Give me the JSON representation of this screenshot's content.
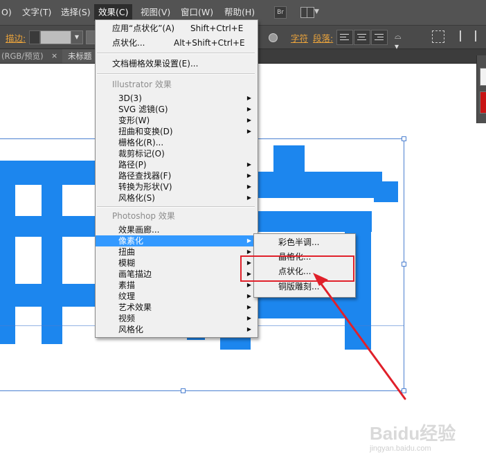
{
  "menubar": {
    "items": [
      "O)",
      "文字(T)",
      "选择(S)",
      "效果(C)",
      "视图(V)",
      "窗口(W)",
      "帮助(H)"
    ],
    "bridge_badge": "Br"
  },
  "control_bar": {
    "stroke_label": "描边:",
    "character_label": "字符",
    "paragraph_label": "段落:"
  },
  "tabs": {
    "doc_tab": "(RGB/预览)",
    "doc_tab_close": "×",
    "untitled_tab": "未标题"
  },
  "effect_menu": {
    "apply_last": {
      "label": "应用“点状化”(A)",
      "shortcut": "Shift+Ctrl+E"
    },
    "last_effect": {
      "label": "点状化...",
      "shortcut": "Alt+Shift+Ctrl+E"
    },
    "raster_settings": "文档栅格效果设置(E)...",
    "illustrator_header": "Illustrator 效果",
    "illustrator_items": [
      "3D(3)",
      "SVG 滤镜(G)",
      "变形(W)",
      "扭曲和变换(D)",
      "栅格化(R)...",
      "裁剪标记(O)",
      "路径(P)",
      "路径查找器(F)",
      "转换为形状(V)",
      "风格化(S)"
    ],
    "photoshop_header": "Photoshop 效果",
    "photoshop_items": [
      "效果画廊...",
      "像素化",
      "扭曲",
      "模糊",
      "画笔描边",
      "素描",
      "纹理",
      "艺术效果",
      "视频",
      "风格化"
    ]
  },
  "pixelate_submenu": {
    "items": [
      "彩色半调...",
      "晶格化...",
      "点状化...",
      "铜版雕刻..."
    ]
  },
  "watermark": {
    "brand": "Baidu经验",
    "url": "jingyan.baidu.com"
  },
  "colors": {
    "text_fill": "#1c86ee",
    "highlight": "#3399ff",
    "annotation": "#e0202a",
    "menubar_bg": "#535353"
  }
}
